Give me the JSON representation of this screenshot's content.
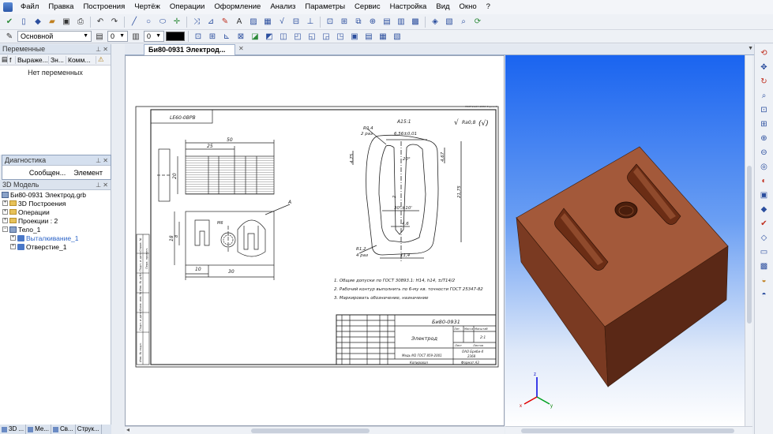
{
  "menu": [
    "Файл",
    "Правка",
    "Построения",
    "Чертёж",
    "Операции",
    "Оформление",
    "Анализ",
    "Параметры",
    "Сервис",
    "Настройка",
    "Вид",
    "Окно",
    "?"
  ],
  "toolbar2": {
    "layer": "Основной",
    "num1": "0",
    "num2": "0"
  },
  "vars_panel": {
    "title": "Переменные",
    "columns": [
      "Выраже...",
      "Зн...",
      "Комм..."
    ],
    "empty": "Нет переменных"
  },
  "diag_panel": {
    "title": "Диагностика",
    "tabs": [
      "Сообщен...",
      "Элемент"
    ]
  },
  "model_panel": {
    "title": "3D Модель",
    "file": "Би80-0931 Электрод.grb",
    "items": [
      "3D Построения",
      "Операции",
      "Проекции : 2",
      "Тело_1",
      "Выталкивание_1",
      "Отверстие_1"
    ]
  },
  "bottom_tabs": [
    "3D ...",
    "Ме...",
    "Св...",
    "Струк..."
  ],
  "document_tab": "Би80-0931 Электрод...",
  "drawing": {
    "designation": "Би80-0931",
    "name": "Электрод",
    "material": "Медь М2 ГОСТ 859-2001",
    "standard": "ГОСТ 2.104-2006 Форма 1",
    "roughness": "Ra0,8",
    "stamp_code": "LE60-0BPB",
    "notes": [
      "1. Общие допуски по ГОСТ 30893.1: H14, h14, ±IT14/2",
      "2. Рабочий контур выполнить по 6-му кв. точности ГОСТ 25347-82",
      "3. Маркировать обозначение, назначение"
    ],
    "dims": {
      "d50": "50",
      "d25": "25",
      "d20": "20",
      "d10": "10",
      "d30": "30",
      "d18": "18",
      "d8": "8",
      "m6": "M6",
      "r04": "R0,4",
      "r04b": "2 раз",
      "w656": "6,56±0,01",
      "a15": "А15:1",
      "a20": "20°",
      "a30": "30°±10'",
      "d46": "4,6",
      "d114": "11,4",
      "d2175": "21,75",
      "d475": "4,75",
      "d467": "4,67",
      "r12": "R1,2",
      "r12b": "4 раз",
      "n2": "2"
    },
    "title_block": {
      "sheet": "Лист",
      "sheets": "Листов",
      "scale": "Масштаб",
      "mass": "Масса",
      "fmt": "Формат А3",
      "copy": "Копировал",
      "liter": "Лит.",
      "scale_val": "2:1",
      "org1": "ОАО Бреби-4",
      "org2": "2368"
    },
    "vertical_labels": [
      "Инв. № подл.",
      "Подп. и дата",
      "Взам. инв. №",
      "Инв. № дубл.",
      "Подп. и дата",
      "Справ. №",
      "Перв. примен."
    ]
  },
  "colors": {
    "block_front": "#7a3a22",
    "block_top": "#a3593a",
    "block_side": "#5a2816"
  }
}
